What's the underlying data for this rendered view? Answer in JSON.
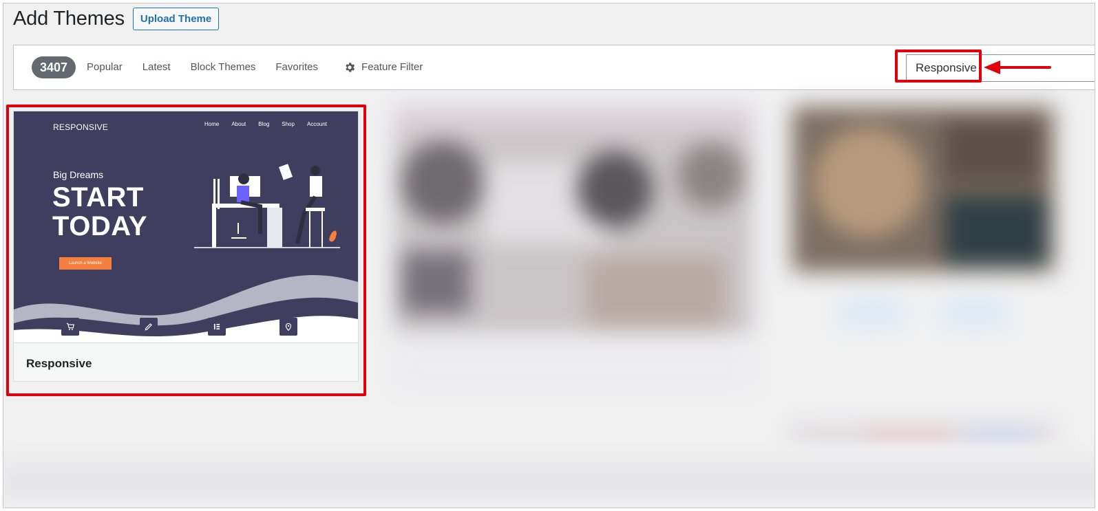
{
  "header": {
    "title": "Add Themes",
    "upload_button": "Upload Theme"
  },
  "filter_bar": {
    "count": "3407",
    "tabs": [
      "Popular",
      "Latest",
      "Block Themes",
      "Favorites"
    ],
    "feature_filter": "Feature Filter",
    "search_value": "Responsive"
  },
  "theme_card": {
    "name": "Responsive",
    "preview": {
      "logo": "RESPONSIVE",
      "nav": [
        "Home",
        "About",
        "Blog",
        "Shop",
        "Account"
      ],
      "subtitle": "Big Dreams",
      "headline_1": "START",
      "headline_2": "TODAY",
      "button": "Launch a Website"
    }
  },
  "colors": {
    "highlight": "#e1000a",
    "accent": "#2271b1",
    "preview_bg": "#403e5e",
    "preview_button": "#f47f3f"
  }
}
